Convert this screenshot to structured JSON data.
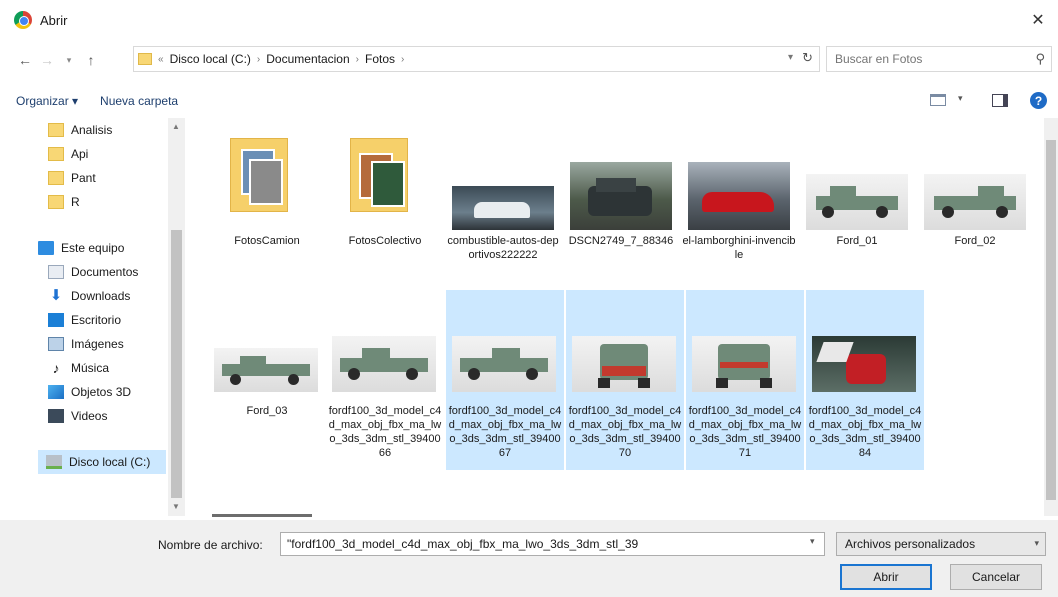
{
  "window": {
    "title": "Abrir",
    "close_glyph": "✕"
  },
  "nav": {
    "back_glyph": "←",
    "forward_glyph": "→",
    "recent_glyph": "▾",
    "up_glyph": "↑",
    "breadcrumbs": [
      "Disco local (C:)",
      "Documentacion",
      "Fotos"
    ],
    "search_placeholder": "Buscar en Fotos"
  },
  "toolbar": {
    "organizar": "Organizar ▾",
    "nueva_carpeta": "Nueva carpeta"
  },
  "sidebar": {
    "items": [
      {
        "label": "Analisis",
        "icon": "folder-icon"
      },
      {
        "label": "Api",
        "icon": "folder-icon"
      },
      {
        "label": "Pant",
        "icon": "folder-icon"
      },
      {
        "label": "R",
        "icon": "folder-icon"
      },
      {
        "label": "Este equipo",
        "icon": "computer-icon"
      },
      {
        "label": "Documentos",
        "icon": "documents-icon"
      },
      {
        "label": "Downloads",
        "icon": "download-icon"
      },
      {
        "label": "Escritorio",
        "icon": "desktop-icon"
      },
      {
        "label": "Imágenes",
        "icon": "pictures-icon"
      },
      {
        "label": "Música",
        "icon": "music-icon"
      },
      {
        "label": "Objetos 3D",
        "icon": "3d-objects-icon"
      },
      {
        "label": "Videos",
        "icon": "videos-icon"
      },
      {
        "label": "Disco local (C:)",
        "icon": "drive-icon",
        "selected": true
      }
    ]
  },
  "files": [
    {
      "name": "FotosCamion",
      "kind": "folder"
    },
    {
      "name": "FotosColectivo",
      "kind": "folder"
    },
    {
      "name": "combustible-autos-deportivos222222",
      "kind": "image"
    },
    {
      "name": "DSCN2749_7_88346",
      "kind": "image"
    },
    {
      "name": "el-lamborghini-invencible",
      "kind": "image"
    },
    {
      "name": "Ford_01",
      "kind": "image"
    },
    {
      "name": "Ford_02",
      "kind": "image"
    },
    {
      "name": "Ford_03",
      "kind": "image"
    },
    {
      "name": "fordf100_3d_model_c4d_max_obj_fbx_ma_lwo_3ds_3dm_stl_3940066",
      "kind": "image"
    },
    {
      "name": "fordf100_3d_model_c4d_max_obj_fbx_ma_lwo_3ds_3dm_stl_3940067",
      "kind": "image",
      "selected": true
    },
    {
      "name": "fordf100_3d_model_c4d_max_obj_fbx_ma_lwo_3ds_3dm_stl_3940070",
      "kind": "image",
      "selected": true
    },
    {
      "name": "fordf100_3d_model_c4d_max_obj_fbx_ma_lwo_3ds_3dm_stl_3940071",
      "kind": "image",
      "selected": true
    },
    {
      "name": "fordf100_3d_model_c4d_max_obj_fbx_ma_lwo_3ds_3dm_stl_3940084",
      "kind": "image",
      "selected": true
    }
  ],
  "footer": {
    "filename_label": "Nombre de archivo:",
    "filename_value": "\"fordf100_3d_model_c4d_max_obj_fbx_ma_lwo_3ds_3dm_stl_39",
    "filetype": "Archivos personalizados",
    "open": "Abrir",
    "cancel": "Cancelar"
  },
  "colors": {
    "selection": "#cce8ff",
    "accent": "#1a75d1",
    "folder": "#f6d06a"
  }
}
